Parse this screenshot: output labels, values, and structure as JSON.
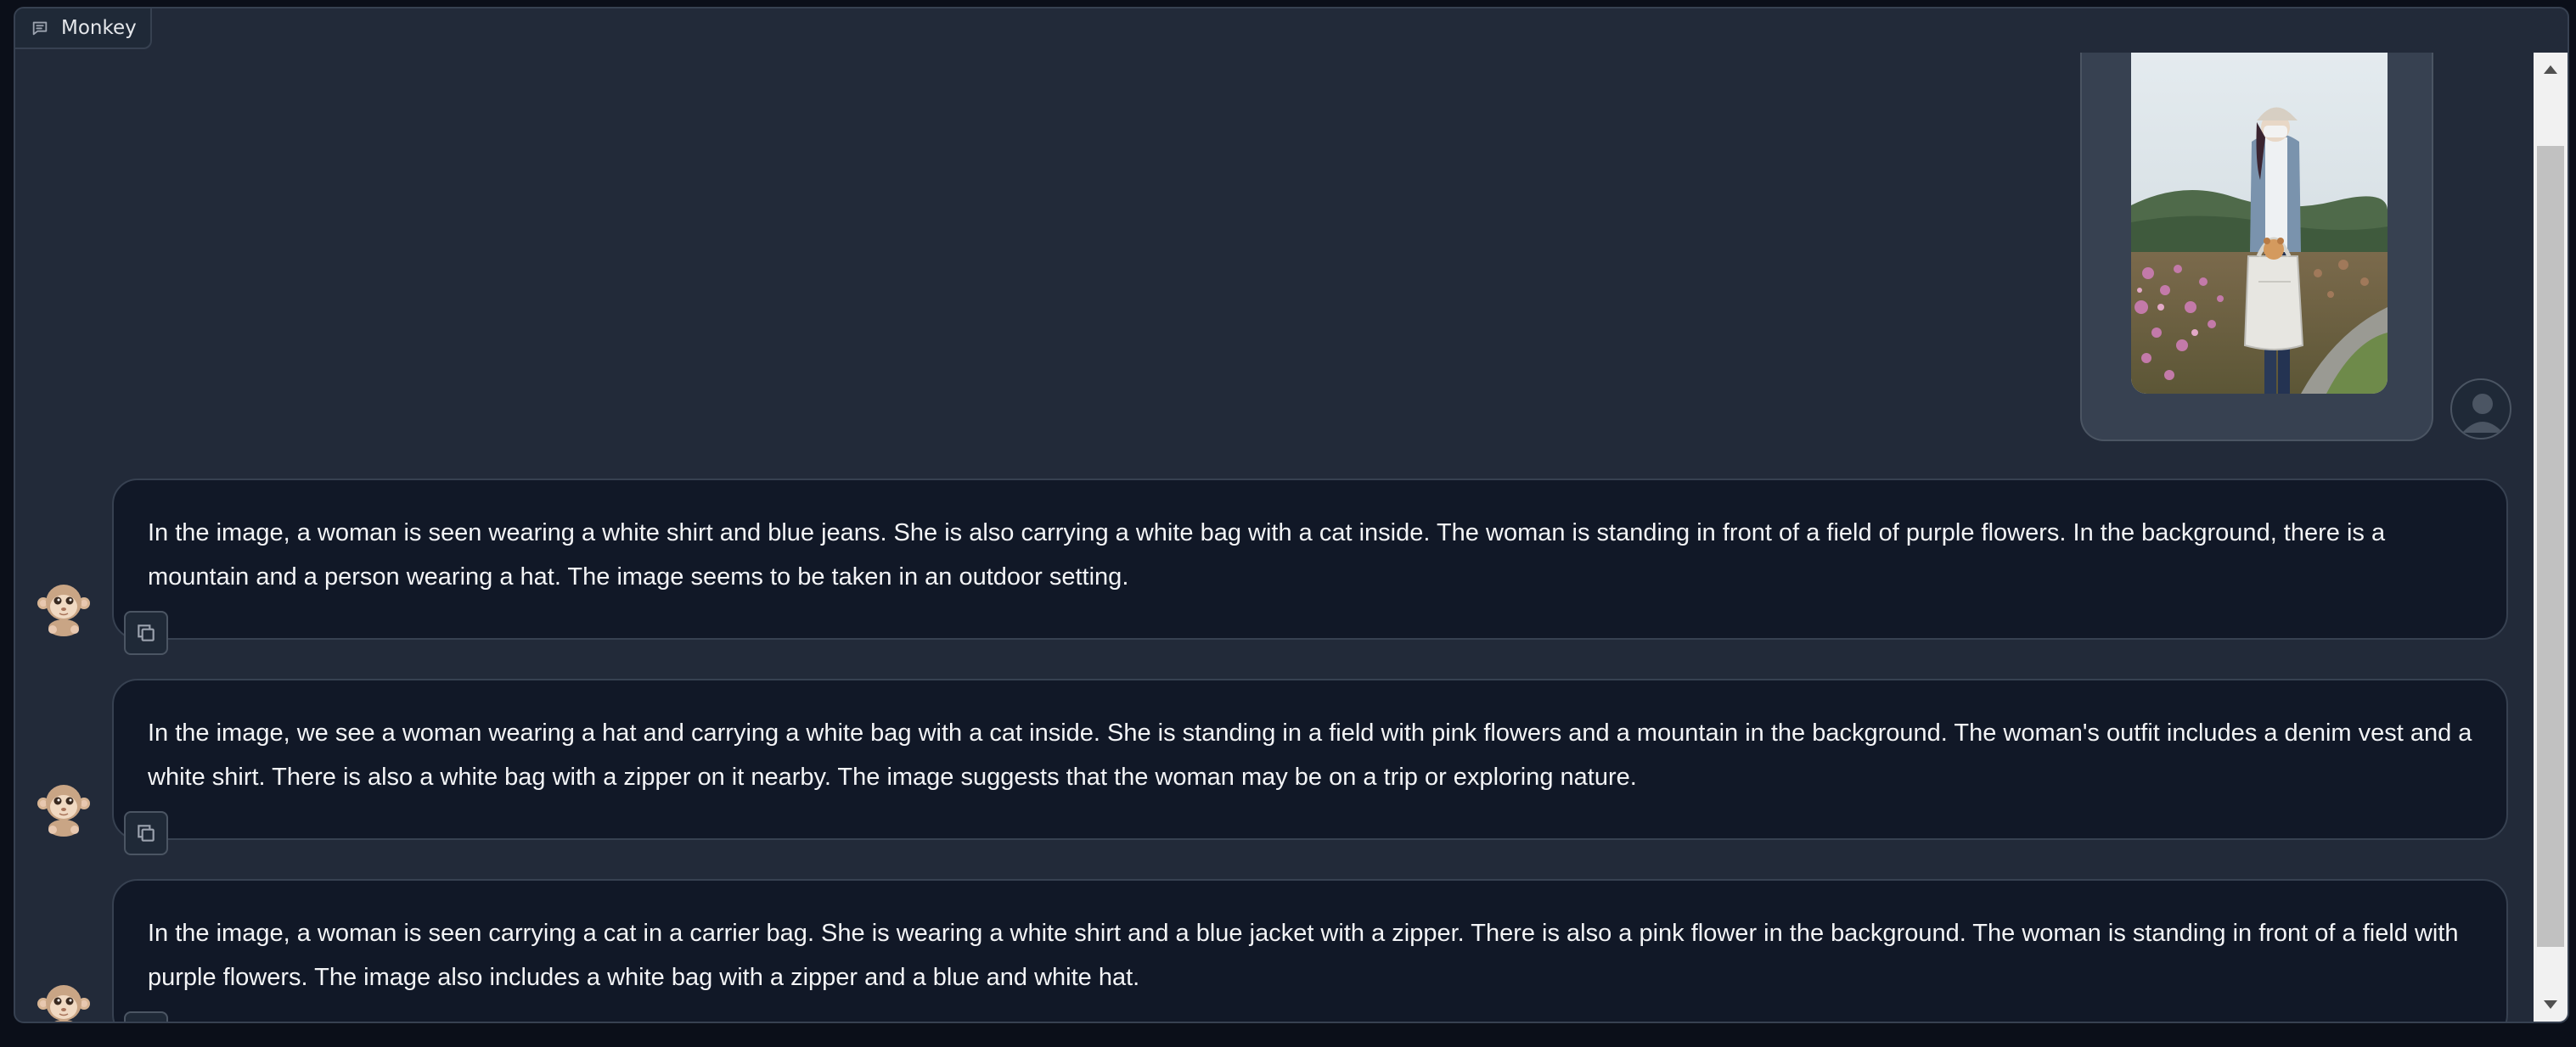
{
  "chatbot": {
    "label": "Monkey",
    "colors": {
      "background": "#222a39",
      "bubble": "#111827",
      "border": "#374151"
    },
    "user_message": {
      "image_alt": "woman-with-cat-bag-in-flower-field"
    },
    "responses": [
      {
        "text": "In the image, a woman is seen wearing a white shirt and blue jeans. She is also carrying a white bag with a cat inside. The woman is standing in front of a field of purple flowers. In the background, there is a mountain and a person wearing a hat. The image seems to be taken in an outdoor setting."
      },
      {
        "text": "In the image, we see a woman wearing a hat and carrying a white bag with a cat inside. She is standing in a field with pink flowers and a mountain in the background. The woman's outfit includes a denim vest and a white shirt. There is also a white bag with a zipper on it nearby. The image suggests that the woman may be on a trip or exploring nature."
      },
      {
        "text": "In the image, a woman is seen carrying a cat in a carrier bag. She is wearing a white shirt and a blue jacket with a zipper. There is also a pink flower in the background. The woman is standing in front of a field with purple flowers. The image also includes a white bag with a zipper and a blue and white hat."
      }
    ],
    "icons": {
      "label": "chat-icon",
      "copy": "copy-icon",
      "bot": "monkey-avatar",
      "user": "user-avatar"
    }
  }
}
